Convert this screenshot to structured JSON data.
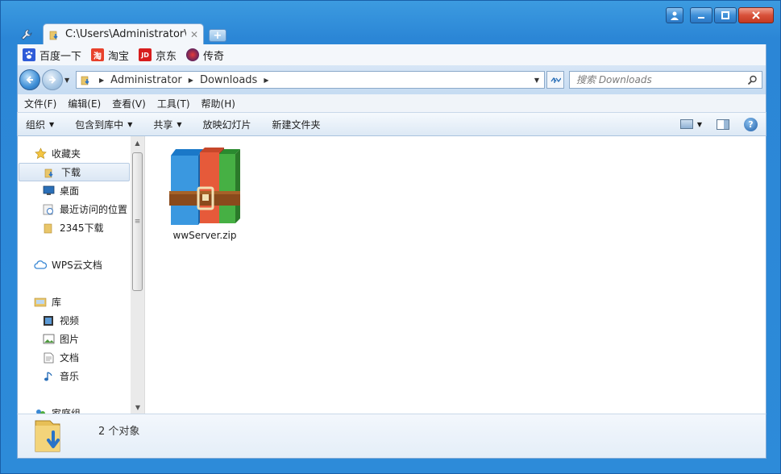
{
  "window": {
    "tab_title": "C:\\Users\\Administrator\\D",
    "controls": {
      "user": "user",
      "minimize": "—",
      "maximize": "□",
      "close": "✕"
    }
  },
  "bookmarks": [
    {
      "label": "百度一下",
      "icon": "baidu-icon",
      "color": "#2f5bd8"
    },
    {
      "label": "淘宝",
      "icon": "taobao-icon",
      "color": "#e8412c",
      "glyph": "淘"
    },
    {
      "label": "京东",
      "icon": "jd-icon",
      "color": "#d71d1d",
      "glyph": "JD"
    },
    {
      "label": "传奇",
      "icon": "game-icon",
      "color": "#3b2a8c"
    }
  ],
  "address": {
    "breadcrumbs": [
      "Administrator",
      "Downloads"
    ]
  },
  "search": {
    "placeholder": "搜索 Downloads"
  },
  "menu": [
    "文件(F)",
    "编辑(E)",
    "查看(V)",
    "工具(T)",
    "帮助(H)"
  ],
  "commands": [
    {
      "label": "组织",
      "dropdown": true
    },
    {
      "label": "包含到库中",
      "dropdown": true
    },
    {
      "label": "共享",
      "dropdown": true
    },
    {
      "label": "放映幻灯片",
      "dropdown": false
    },
    {
      "label": "新建文件夹",
      "dropdown": false
    }
  ],
  "navpane": {
    "favorites": "收藏夹",
    "downloads": "下载",
    "desktop": "桌面",
    "recent": "最近访问的位置",
    "dl2345": "2345下载",
    "wps": "WPS云文档",
    "library": "库",
    "video": "视频",
    "pictures": "图片",
    "documents": "文档",
    "music": "音乐",
    "homegroup": "家庭组"
  },
  "files": [
    {
      "name": "wwServer.zip",
      "icon": "winrar-archive-icon"
    }
  ],
  "status": {
    "count": "2 个对象"
  },
  "colors": {
    "accent": "#2b86d6",
    "selection": "#dbe7f4"
  }
}
